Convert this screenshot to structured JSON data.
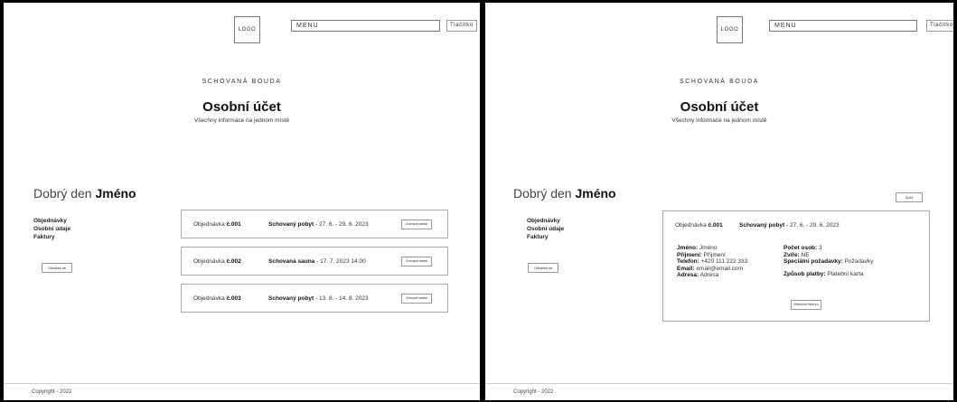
{
  "header": {
    "logo": "LOGO",
    "menu": "MENU",
    "button": "Tlačítko"
  },
  "hero": {
    "brand": "SCHOVANÁ BOUDA",
    "title": "Osobní účet",
    "subtitle": "Všechny informace na jednom místě"
  },
  "greeting": {
    "prefix": "Dobrý den",
    "name": "Jméno"
  },
  "sidebar": {
    "items": [
      {
        "label": "Objednávky"
      },
      {
        "label": "Osobní údaje"
      },
      {
        "label": "Faktury"
      }
    ],
    "logout": "Odhlásit se"
  },
  "orders": [
    {
      "prefix": "Objednávka",
      "number": "č.001",
      "title": "Schovaný pobyt",
      "dates": " - 27. 6. - 29. 6. 2023",
      "button": "Zobrazit detail"
    },
    {
      "prefix": "Objednávka",
      "number": "č.002",
      "title": "Schovaná sauna",
      "dates": " - 17. 7. 2023 14:00",
      "button": "Zobrazit detail"
    },
    {
      "prefix": "Objednávka",
      "number": "č.003",
      "title": "Schovaný pobyt",
      "dates": " - 13. 8. - 14. 8. 2023",
      "button": "Zobrazit detail"
    }
  ],
  "detail": {
    "back": "Zpět",
    "prefix": "Objednávka",
    "number": "č.001",
    "title": "Schovaný pobyt",
    "dates": " - 27. 6. - 29. 6. 2023",
    "left": [
      {
        "label": "Jméno:",
        "value": " Jméno"
      },
      {
        "label": "Příjmení:",
        "value": " Příjmení"
      },
      {
        "label": "Telefon:",
        "value": " +420 111 222 333"
      },
      {
        "label": "Email:",
        "value": " email@email.com"
      },
      {
        "label": "Adresa:",
        "value": " Adresa"
      }
    ],
    "right": [
      {
        "label": "Počet osob:",
        "value": " 3"
      },
      {
        "label": "Zvíře:",
        "value": " NE"
      },
      {
        "label": "Speciální požadavky:",
        "value": " Požadavky"
      }
    ],
    "payment": {
      "label": "Způsob platby:",
      "value": " Platební karta"
    },
    "invoice": "Stáhnout fakturu"
  },
  "footer": {
    "copyright": "Copyright - 2022"
  }
}
